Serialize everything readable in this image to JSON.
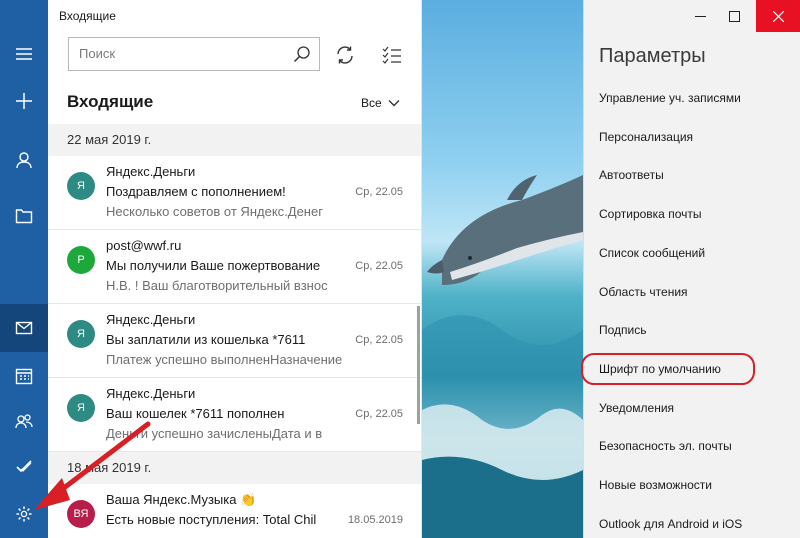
{
  "window": {
    "title": "Входящие"
  },
  "search": {
    "placeholder": "Поиск"
  },
  "folder": {
    "heading": "Входящие",
    "filter": "Все"
  },
  "date_groups": [
    "22 мая 2019 г.",
    "18 мая 2019 г."
  ],
  "messages": [
    {
      "initial": "Я",
      "avatar_color": "#2e8b84",
      "sender": "Яндекс.Деньги",
      "subject": "Поздравляем с пополнением!",
      "preview": "Несколько советов от Яндекс.Денег",
      "date": "Ср, 22.05"
    },
    {
      "initial": "P",
      "avatar_color": "#1ea83c",
      "sender": "post@wwf.ru",
      "subject": "Мы получили Ваше пожертвование",
      "preview": "Н.В. ! Ваш благотворительный взнос",
      "date": "Ср, 22.05"
    },
    {
      "initial": "Я",
      "avatar_color": "#2e8b84",
      "sender": "Яндекс.Деньги",
      "subject": "Вы заплатили из кошелька *7611",
      "preview": "Платеж успешно выполненНазначение",
      "date": "Ср, 22.05"
    },
    {
      "initial": "Я",
      "avatar_color": "#2e8b84",
      "sender": "Яндекс.Деньги",
      "subject": "Ваш кошелек *7611 пополнен",
      "preview": "Деньги успешно зачисленыДата и в",
      "date": "Ср, 22.05"
    },
    {
      "initial": "ВЯ",
      "avatar_color": "#b81e4a",
      "sender": "Ваша Яндекс.Музыка 👏",
      "subject": "Есть новые поступления: Total Chil",
      "preview": "",
      "date": "18.05.2019"
    }
  ],
  "settings": {
    "title": "Параметры",
    "items": [
      "Управление уч. записями",
      "Персонализация",
      "Автоответы",
      "Сортировка почты",
      "Список сообщений",
      "Область чтения",
      "Подпись",
      "Шрифт по умолчанию",
      "Уведомления",
      "Безопасность эл. почты",
      "Новые возможности",
      "Outlook для Android и iOS"
    ],
    "highlighted_item": "Шрифт по умолчанию"
  },
  "colors": {
    "rail": "#1f5fa3",
    "highlight_ring": "#d81f26",
    "arrow": "#d81f26",
    "close_button": "#e81123"
  },
  "icons": [
    "menu-icon",
    "new-mail-icon",
    "accounts-icon",
    "folders-icon",
    "mail-icon",
    "calendar-icon",
    "people-icon",
    "todo-icon",
    "settings-icon",
    "search-icon",
    "sync-icon",
    "select-mode-icon",
    "chevron-down-icon",
    "minimize-icon",
    "maximize-icon",
    "close-icon"
  ]
}
